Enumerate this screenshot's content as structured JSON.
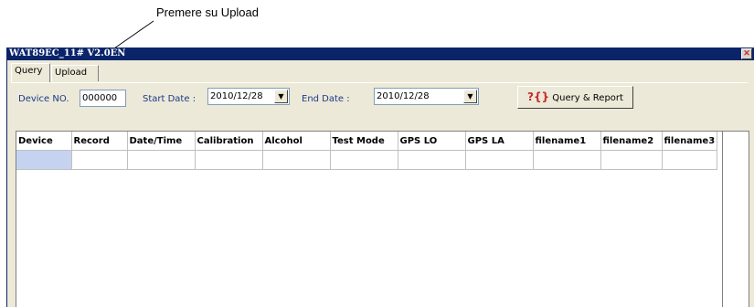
{
  "annotation": {
    "text": "Premere su Upload"
  },
  "window": {
    "title": "WAT89EC_11# V2.0EN",
    "close_glyph": "✕"
  },
  "tabs": [
    {
      "label": "Query",
      "active": true
    },
    {
      "label": "Upload",
      "active": false
    }
  ],
  "form": {
    "device_label": "Device NO.",
    "device_value": "000000",
    "start_label": "Start Date :",
    "start_value": "2010/12/28",
    "end_label": "End Date :",
    "end_value": "2010/12/28",
    "query_button": "Query & Report",
    "query_icon": "?{}"
  },
  "table": {
    "columns": [
      "Device",
      "Record",
      "Date/Time",
      "Calibration",
      "Alcohol",
      "Test Mode",
      "GPS LO",
      "GPS LA",
      "filename1",
      "filename2",
      "filename3"
    ],
    "rows": [
      [
        "",
        "",
        "",
        "",
        "",
        "",
        "",
        "",
        "",
        "",
        ""
      ]
    ]
  },
  "colors": {
    "title_bar": "#0a246a",
    "label_blue": "#1a3a8a",
    "selected_cell": "#c6d3f0",
    "accent_red": "#c62828"
  }
}
